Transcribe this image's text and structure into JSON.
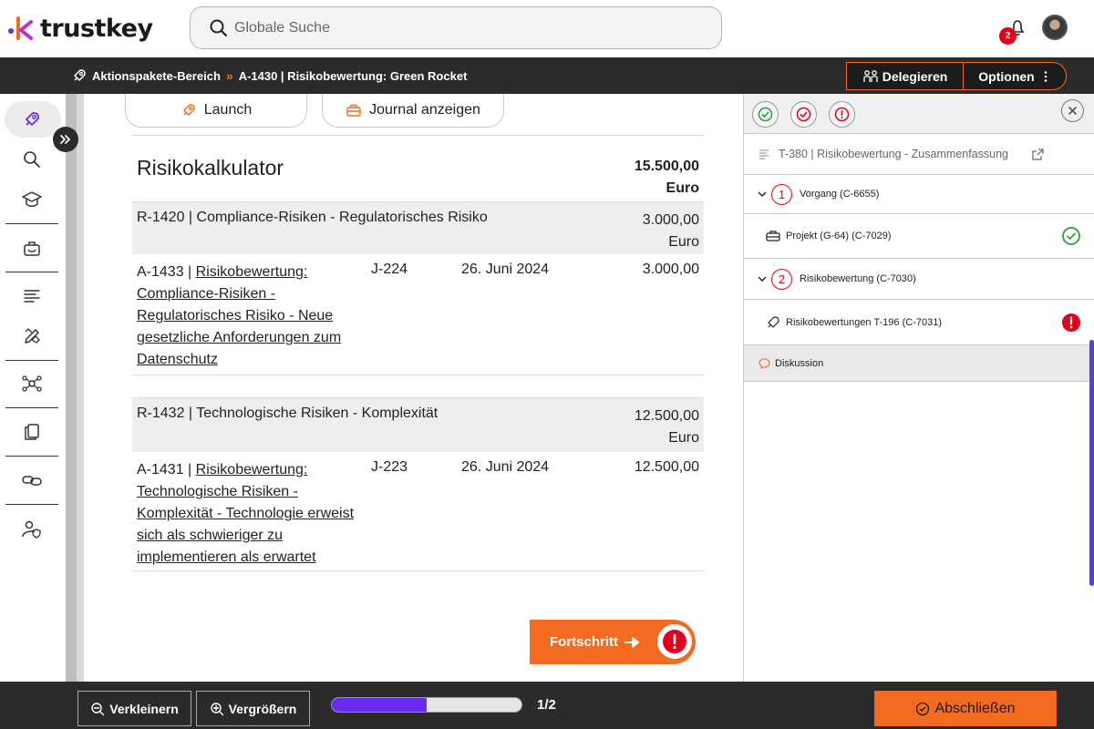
{
  "header": {
    "logo_text": "trustkey",
    "search_placeholder": "Globale Suche",
    "notification_count": "2"
  },
  "breadcrumb": {
    "items": [
      "Aktionspakete-Bereich",
      "A-1430 | Risikobewertung: Green Rocket"
    ],
    "separator": "»"
  },
  "actions": {
    "delegate_label": "Delegieren",
    "options_label": "Optionen"
  },
  "sidebar": {
    "items": [
      "rocket-icon",
      "search-icon",
      "graduation-cap-icon",
      "toolbox-icon",
      "list-icon",
      "edit-tools-icon",
      "network-icon",
      "documents-icon",
      "link-icon",
      "user-shield-icon"
    ],
    "active_index": 0
  },
  "main": {
    "tabs": [
      {
        "label": "Launch",
        "icon": "rocket-icon"
      },
      {
        "label": "Journal anzeigen",
        "icon": "toolbox-icon"
      }
    ],
    "calculator": {
      "title": "Risikokalkulator",
      "total_amount": "15.500,00",
      "total_currency": "Euro"
    },
    "groups": [
      {
        "label": "R-1420 | Compliance-Risiken - Regulatorisches Risiko",
        "amount": "3.000,00",
        "currency": "Euro",
        "rows": [
          {
            "id": "A-1433 | ",
            "link": "Risikobewertung: Compliance-Risiken - Regulatorisches Risiko - Neue gesetzliche Anforderungen zum Datenschutz",
            "journal": "J-224",
            "date": "26. Juni 2024",
            "amount": "3.000,00"
          }
        ]
      },
      {
        "label": "R-1432 | Technologische Risiken - Komplexität",
        "amount": "12.500,00",
        "currency": "Euro",
        "rows": [
          {
            "id": "A-1431 | ",
            "link": "Risikobewertung: Technologische Risiken - Komplexität - Technologie erweist sich als schwieriger zu implementieren als erwartet",
            "journal": "J-223",
            "date": "26. Juni 2024",
            "amount": "12.500,00"
          }
        ]
      }
    ],
    "progress_button_label": "Fortschritt"
  },
  "right_panel": {
    "summary_title": "T-380 | Risikobewertung - Zusammenfassung",
    "sections": [
      {
        "number": "1",
        "label": "Vorgang (C-6655)"
      },
      {
        "number": "2",
        "label": "Risikobewertung (C-7030)"
      }
    ],
    "items": [
      {
        "label": "Projekt (G-64) (C-7029)",
        "status": "done"
      },
      {
        "label": "Risikobewertungen T-196 (C-7031)",
        "status": "warning"
      }
    ],
    "discussion_label": "Diskussion"
  },
  "bottom": {
    "zoom_out_label": "Verkleinern",
    "zoom_in_label": "Vergrößern",
    "progress_fraction": 0.5,
    "page_indicator": "1/2",
    "finish_label": "Abschließen"
  },
  "colors": {
    "accent": "#f26b21",
    "progress": "#6a2bf0",
    "alert": "#e3001b",
    "success": "#2a9d3a",
    "dark": "#2b2b2b"
  }
}
